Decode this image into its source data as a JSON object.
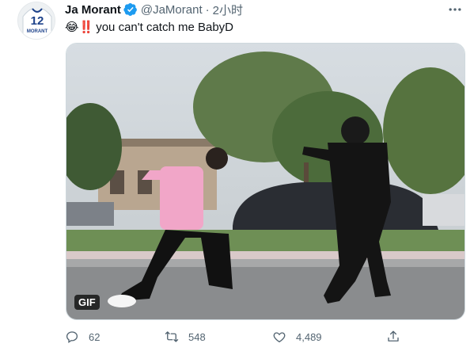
{
  "tweet": {
    "author_name": "Ja Morant",
    "author_handle": "@JaMorant",
    "separator": "·",
    "time": "2小时",
    "avatar_jersey_number": "12",
    "avatar_jersey_name": "MORANT",
    "text_emoji": "😂‼️",
    "text": "you can't catch me BabyD",
    "media_badge": "GIF",
    "actions": {
      "reply_count": "62",
      "retweet_count": "548",
      "like_count": "4,489"
    }
  },
  "colors": {
    "verified": "#1d9bf0",
    "secondary_text": "#536471",
    "primary_text": "#0f1419"
  },
  "icons": [
    "verified-badge-icon",
    "more-icon",
    "reply-icon",
    "retweet-icon",
    "like-icon",
    "share-icon"
  ]
}
